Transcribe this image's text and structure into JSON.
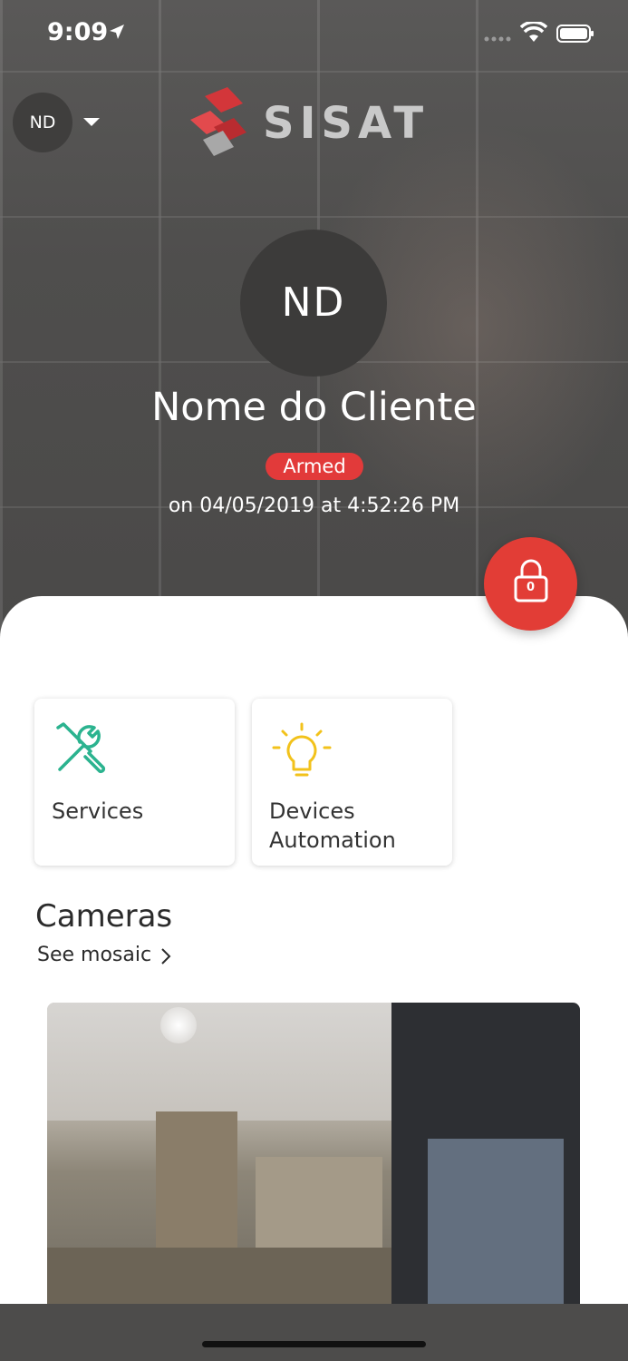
{
  "status_bar": {
    "time": "9:09"
  },
  "header": {
    "account_initials": "ND",
    "brand_name": "SISAT"
  },
  "profile": {
    "initials": "ND",
    "name": "Nome do Cliente",
    "status": "Armed",
    "status_time": "on 04/05/2019 at 4:52:26 PM",
    "status_color": "#e23a3a"
  },
  "lock_button": {
    "count": "0",
    "icon": "lock-icon"
  },
  "shortcuts": [
    {
      "label": "Services",
      "icon": "tools-icon",
      "color": "#2bb38f"
    },
    {
      "label": "Devices Automation",
      "icon": "lightbulb-icon",
      "color": "#f2c21b"
    }
  ],
  "cameras": {
    "title": "Cameras",
    "see_mosaic": "See mosaic"
  }
}
